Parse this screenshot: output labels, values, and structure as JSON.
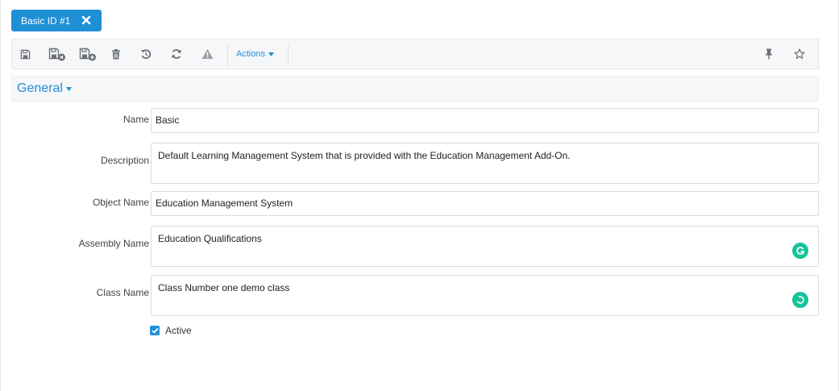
{
  "tab": {
    "label": "Basic ID #1"
  },
  "toolbar": {
    "buttons": [
      {
        "icon": "save-icon"
      },
      {
        "icon": "save-and-close-icon"
      },
      {
        "icon": "save-and-new-icon"
      },
      {
        "icon": "delete-icon"
      },
      {
        "icon": "undo-icon"
      },
      {
        "icon": "refresh-icon"
      },
      {
        "icon": "warning-icon"
      }
    ],
    "actions_label": "Actions",
    "right_icons": [
      "pin-icon",
      "star-icon"
    ]
  },
  "section": {
    "title": "General"
  },
  "form": {
    "name": {
      "label": "Name",
      "value": "Basic"
    },
    "description": {
      "label": "Description",
      "value": "Default Learning Management System that is provided with the Education Management Add-On."
    },
    "object_name": {
      "label": "Object Name",
      "value": "Education Management System"
    },
    "assembly_name": {
      "label": "Assembly Name",
      "value": "Education Qualifications"
    },
    "class_name": {
      "label": "Class Name",
      "value": "Class Number one demo class"
    },
    "active": {
      "label": "Active",
      "checked": true
    }
  },
  "colors": {
    "accent": "#1f8fd6",
    "grammarly": "#15c39a",
    "icon_gray": "#6b6f75"
  }
}
